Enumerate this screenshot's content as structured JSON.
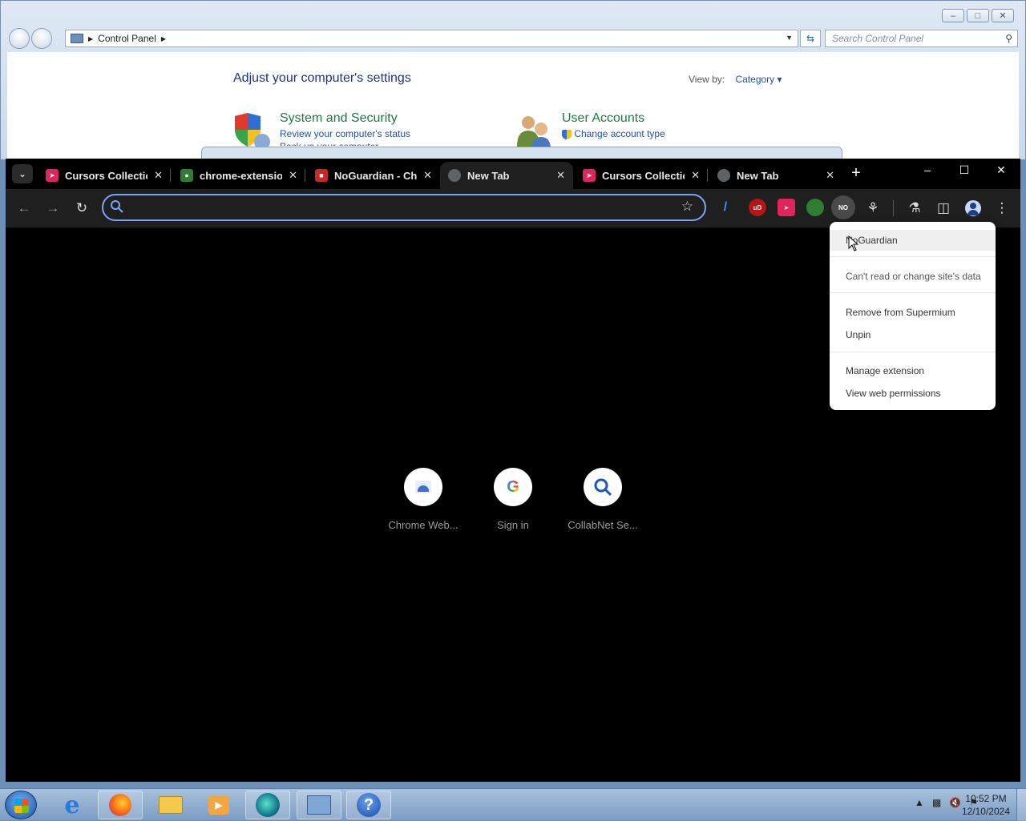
{
  "control_panel": {
    "breadcrumb": "Control Panel",
    "search_placeholder": "Search Control Panel",
    "heading": "Adjust your computer's settings",
    "view_by_label": "View by:",
    "view_by_value": "Category",
    "categories": [
      {
        "title": "System and Security",
        "link1": "Review your computer's status",
        "link2": "Back up your computer"
      },
      {
        "title": "User Accounts",
        "link1": "Change account type"
      }
    ]
  },
  "chrome": {
    "tabs": [
      {
        "title": "Cursors Collection",
        "favicon_color": "#e0245e"
      },
      {
        "title": "chrome-extension",
        "favicon_color": "#2e7d32"
      },
      {
        "title": "NoGuardian - Chr",
        "favicon_color": "#c62828"
      },
      {
        "title": "New Tab",
        "favicon_color": "#5f6368",
        "active": true
      },
      {
        "title": "Cursors Collection",
        "favicon_color": "#e0245e"
      },
      {
        "title": "New Tab",
        "favicon_color": "#5f6368"
      }
    ],
    "omnibox_value": "",
    "extensions": [
      {
        "name": "pen-extension-icon",
        "label": "/"
      },
      {
        "name": "ublock-icon",
        "label": "uD"
      },
      {
        "name": "cursors-extension-icon",
        "label": ""
      },
      {
        "name": "frog-extension-icon",
        "label": ""
      },
      {
        "name": "noguardian-extension-icon",
        "label": "NO"
      }
    ],
    "shortcuts": [
      {
        "label": "Chrome Web..."
      },
      {
        "label": "Sign in"
      },
      {
        "label": "CollabNet Se..."
      }
    ],
    "context_menu": {
      "title": "NoGuardian",
      "site_access": "Can't read or change site's data",
      "remove": "Remove from Supermium",
      "unpin": "Unpin",
      "manage": "Manage extension",
      "permissions": "View web permissions"
    }
  },
  "taskbar": {
    "time": "10:52 PM",
    "date": "12/10/2024",
    "apps": [
      "internet-explorer",
      "firefox",
      "file-explorer",
      "media-player",
      "supermium",
      "control-panel",
      "help"
    ]
  },
  "colors": {
    "accent": "#7aa5f7",
    "tab_active": "#1f1f1f",
    "cp_link": "#1f4fb5",
    "cp_title_green": "#1e7a44"
  }
}
